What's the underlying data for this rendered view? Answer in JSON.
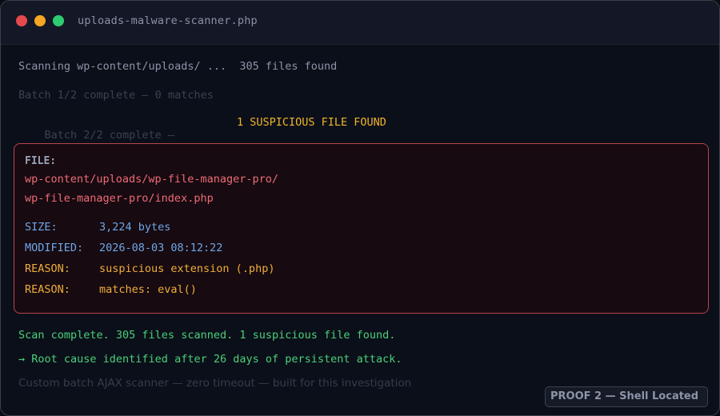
{
  "window": {
    "title": "uploads-malware-scanner.php",
    "controls": [
      "close",
      "minimize",
      "maximize"
    ]
  },
  "log": {
    "scan_start": "Scanning wp-content/uploads/ ...  305 files found",
    "batch1": "Batch 1/2 complete — 0 matches",
    "batch2": "Batch 2/2 complete —",
    "batch2_result": "1 SUSPICIOUS FILE FOUND"
  },
  "alert": {
    "file_label": "FILE:",
    "path_line1": "wp-content/uploads/wp-file-manager-pro/",
    "path_line2": "wp-file-manager-pro/index.php",
    "details": [
      {
        "key": "SIZE:",
        "value": "3,224 bytes"
      },
      {
        "key": "MODIFIED:",
        "value": "2026-08-03 08:12:22"
      },
      {
        "key": "REASON:",
        "value": "suspicious extension (.php)"
      },
      {
        "key": "REASON:",
        "value": "matches: eval()"
      }
    ]
  },
  "summary": {
    "complete": "Scan complete. 305 files scanned. 1 suspicious file found.",
    "root_cause": "→ Root cause identified after 26 days of persistent attack."
  },
  "footer": {
    "note": "Custom batch AJAX scanner — zero timeout — built for this investigation",
    "badge": "PROOF 2 — Shell Located"
  },
  "colors": {
    "close": "#e5484d",
    "minimize": "#f5a623",
    "maximize": "#2ecc71",
    "alert_border": "#b8444e",
    "warning": "#f0b429",
    "success": "#4ad07a"
  }
}
